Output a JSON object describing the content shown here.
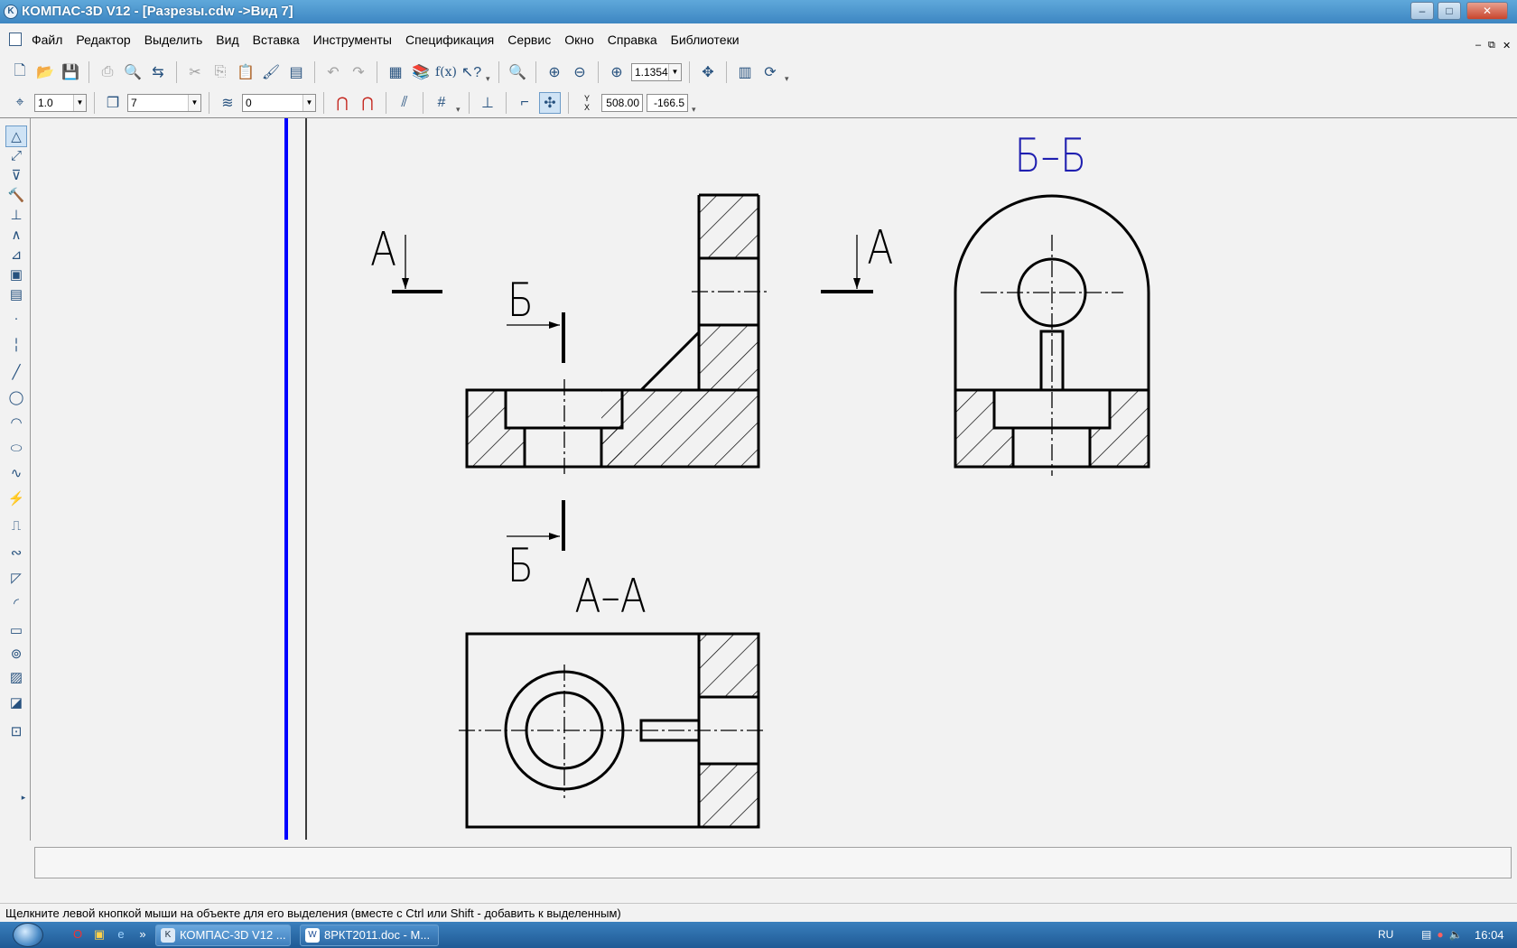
{
  "window": {
    "title": "КОМПАС-3D V12 - [Разрезы.cdw ->Вид 7]",
    "icon": "kompas-logo-icon",
    "controls": {
      "minimize": "–",
      "maximize": "□",
      "close": "✕"
    }
  },
  "menu": {
    "items": [
      "Файл",
      "Редактор",
      "Выделить",
      "Вид",
      "Вставка",
      "Инструменты",
      "Спецификация",
      "Сервис",
      "Окно",
      "Справка",
      "Библиотеки"
    ],
    "mdi_controls": {
      "minimize": "–",
      "restore": "⧉",
      "close": "✕"
    }
  },
  "toolbar_standard": {
    "zoom_value": "1.1354",
    "function_label": "f(x)"
  },
  "toolbar_state": {
    "step_value": "1.0",
    "layer_value": "7",
    "style_value": "0",
    "coord_label": "Y\nX",
    "coord_x": "508.00",
    "coord_y": "-166.5"
  },
  "drawing": {
    "label_a_left": "А",
    "label_a_right": "А",
    "label_b_top": "Б",
    "label_b_bottom": "Б",
    "section_aa_title": "А–А",
    "section_bb_title": "Б–Б",
    "colors": {
      "lines": "#000000",
      "section_bb_title": "#1f1fb0",
      "view_border": "#0000ff",
      "background": "#f2f2f2"
    }
  },
  "status": {
    "message": "Щелкните левой кнопкой мыши на объекте для его выделения (вместе с Ctrl или Shift - добавить к выделенным)"
  },
  "taskbar": {
    "tasks": [
      {
        "label": "КОМПАС-3D V12 ...",
        "icon": "kompas-logo-icon"
      },
      {
        "label": "8РКТ2011.doc - М...",
        "icon": "word-icon"
      }
    ],
    "language": "RU",
    "time": "16:04",
    "quick_launch_extra": "»"
  }
}
